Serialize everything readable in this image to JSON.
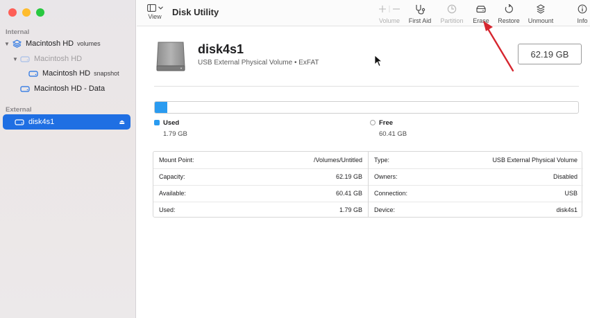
{
  "sidebar": {
    "sections": {
      "internal": "Internal",
      "external": "External"
    },
    "items": [
      {
        "label": "Macintosh HD",
        "sub": "volumes"
      },
      {
        "label": "Macintosh HD",
        "sub": ""
      },
      {
        "label": "Macintosh HD",
        "sub": "snapshot"
      },
      {
        "label": "Macintosh HD - Data",
        "sub": ""
      },
      {
        "label": "disk4s1",
        "sub": ""
      }
    ]
  },
  "toolbar": {
    "view_label": "View",
    "title": "Disk Utility",
    "volume_label": "Volume",
    "first_aid_label": "First Aid",
    "partition_label": "Partition",
    "erase_label": "Erase",
    "restore_label": "Restore",
    "unmount_label": "Unmount",
    "info_label": "Info"
  },
  "disk": {
    "name": "disk4s1",
    "description": "USB External Physical Volume • ExFAT",
    "size": "62.19 GB",
    "used_fraction": 0.029
  },
  "usage": {
    "used_label": "Used",
    "used_value": "1.79 GB",
    "free_label": "Free",
    "free_value": "60.41 GB"
  },
  "colors": {
    "used": "#2a9bf0",
    "selection": "#1f6fe3",
    "arrow": "#d6262f"
  },
  "info_table": {
    "left": [
      {
        "key": "Mount Point:",
        "value": "/Volumes/Untitled"
      },
      {
        "key": "Capacity:",
        "value": "62.19 GB"
      },
      {
        "key": "Available:",
        "value": "60.41 GB"
      },
      {
        "key": "Used:",
        "value": "1.79 GB"
      }
    ],
    "right": [
      {
        "key": "Type:",
        "value": "USB External Physical Volume"
      },
      {
        "key": "Owners:",
        "value": "Disabled"
      },
      {
        "key": "Connection:",
        "value": "USB"
      },
      {
        "key": "Device:",
        "value": "disk4s1"
      }
    ]
  }
}
